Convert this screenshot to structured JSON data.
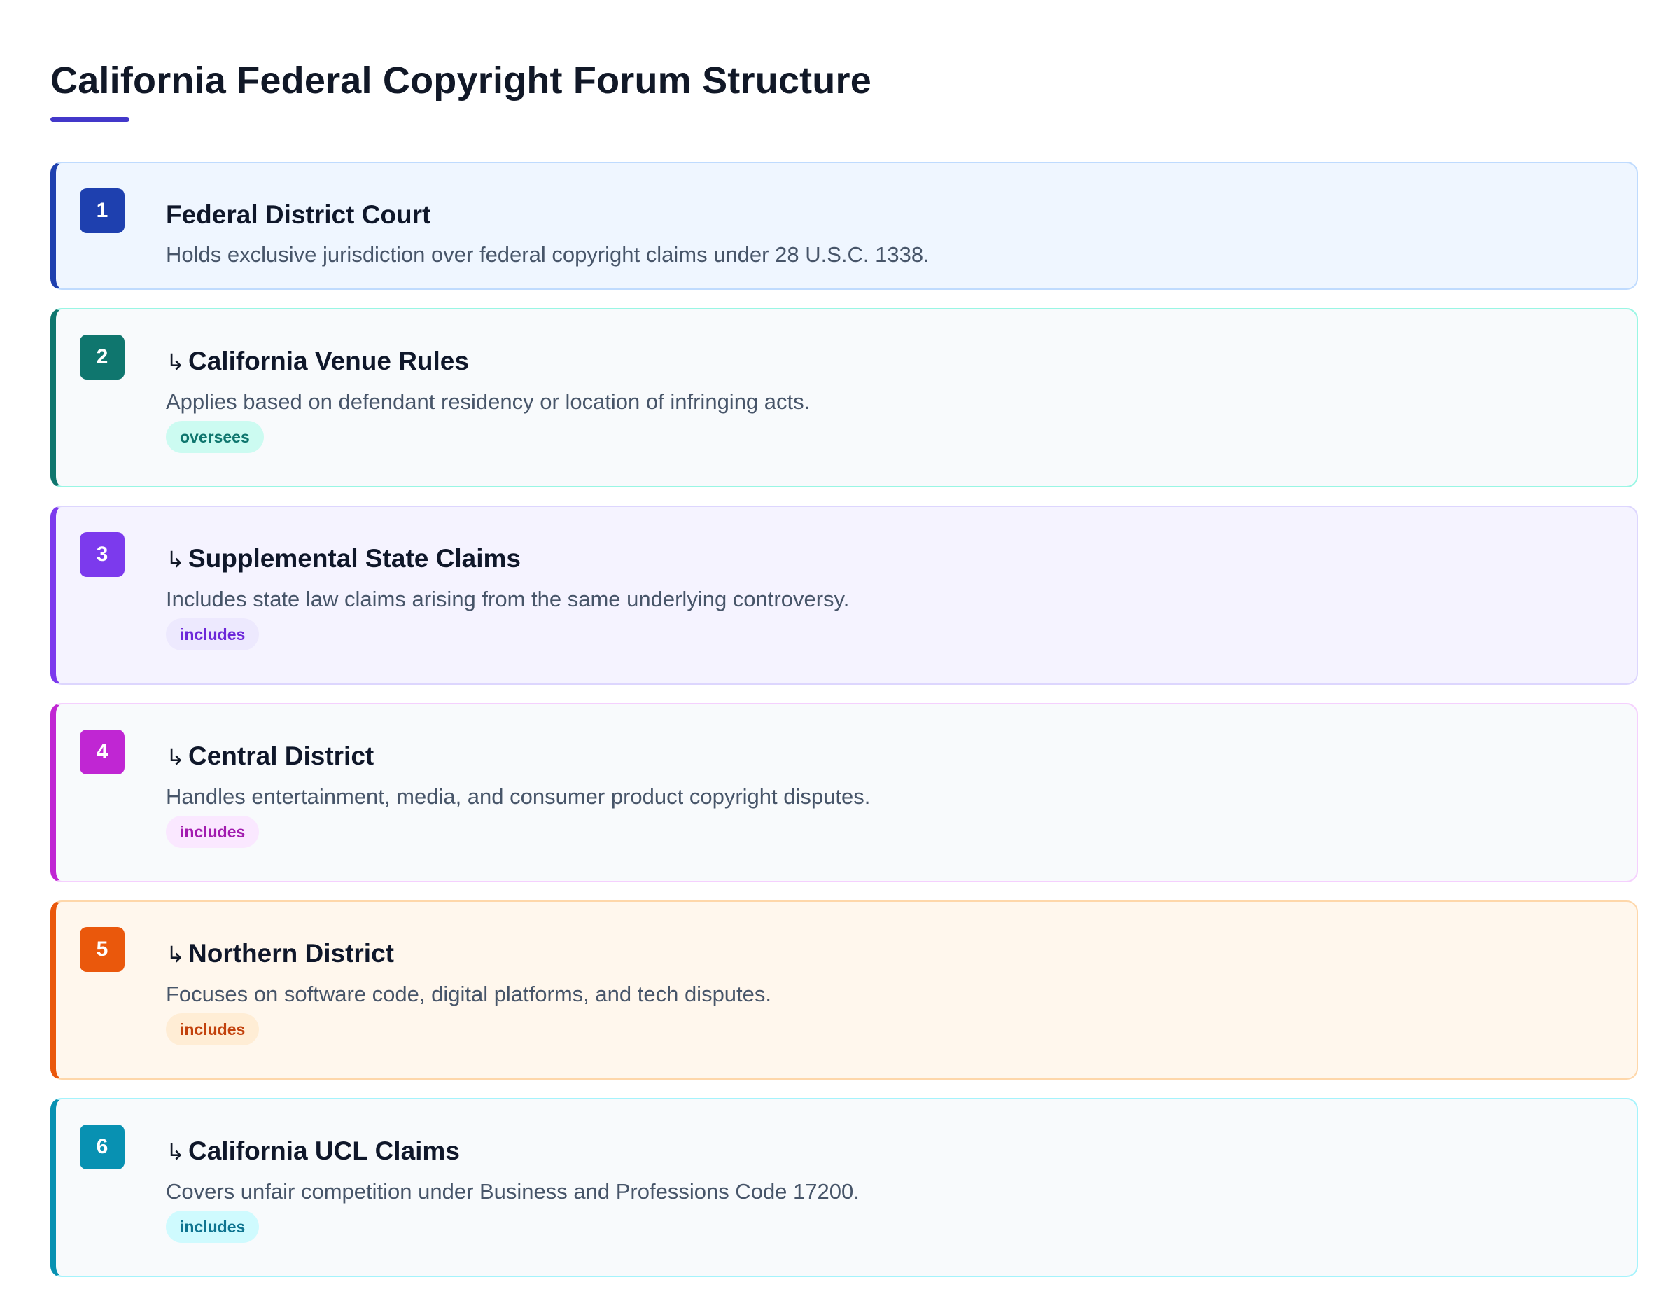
{
  "title": "California Federal Copyright Forum Structure",
  "colors": {
    "title_rule": "#4338ca"
  },
  "nodes": [
    {
      "number": "1",
      "arrow": "",
      "title": "Federal District Court",
      "description": "Holds exclusive jurisdiction over federal copyright claims under 28 U.S.C. 1338.",
      "tag": "",
      "accent": "#1e40af",
      "background": "#eff6ff",
      "border": "#bfdbfe"
    },
    {
      "number": "2",
      "arrow": "↳",
      "title": "California Venue Rules",
      "description": "Applies based on defendant residency or location of infringing acts.",
      "tag": "oversees",
      "accent": "#0f766e",
      "background": "#f8fafc",
      "border": "#99f6e4",
      "tag_background": "#ccfbf1",
      "tag_color": "#0f766e"
    },
    {
      "number": "3",
      "arrow": "↳",
      "title": "Supplemental State Claims",
      "description": "Includes state law claims arising from the same underlying controversy.",
      "tag": "includes",
      "accent": "#7c3aed",
      "background": "#f5f3ff",
      "border": "#ddd6fe",
      "tag_background": "#ede9fe",
      "tag_color": "#6d28d9"
    },
    {
      "number": "4",
      "arrow": "↳",
      "title": "Central District",
      "description": "Handles entertainment, media, and consumer product copyright disputes.",
      "tag": "includes",
      "accent": "#c026d3",
      "background": "#f8fafc",
      "border": "#f5d0fe",
      "tag_background": "#fae8ff",
      "tag_color": "#a21caf"
    },
    {
      "number": "5",
      "arrow": "↳",
      "title": "Northern District",
      "description": "Focuses on software code, digital platforms, and tech disputes.",
      "tag": "includes",
      "accent": "#ea580c",
      "background": "#fff7ed",
      "border": "#fed7aa",
      "tag_background": "#ffedd5",
      "tag_color": "#c2410c"
    },
    {
      "number": "6",
      "arrow": "↳",
      "title": "California UCL Claims",
      "description": "Covers unfair competition under Business and Professions Code 17200.",
      "tag": "includes",
      "accent": "#0891b2",
      "background": "#f8fafc",
      "border": "#a5f3fc",
      "tag_background": "#cffafe",
      "tag_color": "#0e7490"
    }
  ]
}
